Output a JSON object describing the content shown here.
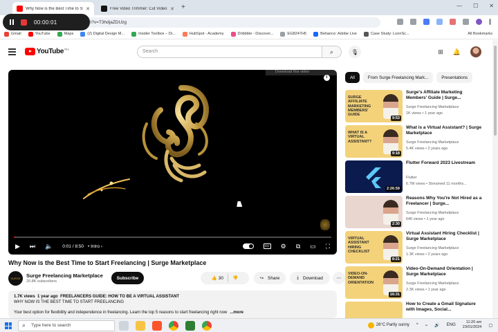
{
  "browser": {
    "tabs": [
      {
        "title": "Why Now is the Best Time to St",
        "favicon_color": "#ff0000"
      },
      {
        "title": "Free Video Trimmer: Cut Video",
        "favicon_color": "#111111"
      }
    ],
    "address": "atch?v=T3hdjaZDUzg",
    "bookmarks": [
      "Gmail",
      "YouTube",
      "Maps",
      "(2) Digital Design M...",
      "Insider Toolbox – Di...",
      "HubSpot - Academy",
      "Dribbble - Discover...",
      "EG8247H5",
      "Behance: Adobe Live",
      "Case Study: LunnSc..."
    ],
    "all_bookmarks": "All Bookmarks"
  },
  "recorder": {
    "time": "00:00:01"
  },
  "youtube": {
    "logo_text": "YouTube",
    "country": "PH",
    "search_placeholder": "Search"
  },
  "player": {
    "overlay_label": "Download this video",
    "progress": 0.002,
    "time_display": "0:01 / 8:50",
    "chapter": "Intro"
  },
  "video": {
    "title": "Why Now is the Best Time to Start Freelancing | Surge Marketplace",
    "channel": "Surge Freelancing Marketplace",
    "channel_avatar_text": "SURGE",
    "subscribers": "20.8K subscribers",
    "subscribe_label": "Subscribe",
    "likes": "30",
    "share_label": "Share",
    "download_label": "Download",
    "description": {
      "views": "1.7K views",
      "ago": "1 year ago",
      "line1": "FREELANCERS GUIDE: HOW TO BE A VIRTUAL ASSISTANT",
      "line2": "WHY NOW IS THE BEST TIME TO START FREELANCING",
      "teaser": "Your best option for flexibility and independence in freelancing. Learn the top 5 reasons to start freelancing right now",
      "more": "...more"
    }
  },
  "chips": [
    "All",
    "From Surge Freelancing Mark...",
    "Presentations"
  ],
  "recommendations": [
    {
      "title": "Surge's Affiliate Marketing Members' Guide | Surge...",
      "channel": "Surge Freelancing Marketplace",
      "views": "1K views",
      "ago": "1 year ago",
      "duration": "9:53",
      "thumb_text": "SURGE AFFILIATE MARKETING MEMBERS' GUIDE",
      "thumb_bg": "#f3d27a",
      "has_face": true
    },
    {
      "title": "What is a Virtual Assistant? | Surge Marketplace",
      "channel": "Surge Freelancing Marketplace",
      "views": "5.4K views",
      "ago": "2 years ago",
      "duration": "9:18",
      "thumb_text": "WHAT IS A VIRTUAL ASSISTANT?",
      "thumb_bg": "#f3d27a",
      "has_face": true
    },
    {
      "title": "Flutter Forward 2023 Livestream",
      "channel": "Flutter",
      "views": "6.7M views",
      "ago": "Streamed 11 months...",
      "duration": "2:26:59",
      "thumb_text": "",
      "thumb_bg": "#0b1b4d",
      "has_face": false
    },
    {
      "title": "Reasons Why You're Not Hired as a Freelancer | Surge...",
      "channel": "Surge Freelancing Marketplace",
      "views": "646 views",
      "ago": "1 year ago",
      "duration": "2:30",
      "thumb_text": "",
      "thumb_bg": "#e8d6cf",
      "has_face": true
    },
    {
      "title": "Virtual Assistant Hiring Checklist | Surge Marketplace",
      "channel": "Surge Freelancing Marketplace",
      "views": "1.3K views",
      "ago": "2 years ago",
      "duration": "8:21",
      "thumb_text": "VIRTUAL ASSISTANT HIRING CHECKLIST",
      "thumb_bg": "#f3d27a",
      "has_face": true
    },
    {
      "title": "Video-On-Demand Orientation | Surge Marketplace",
      "channel": "Surge Freelancing Marketplace",
      "views": "2.3K views",
      "ago": "1 year ago",
      "duration": "16:31",
      "thumb_text": "VIDEO-ON-DEMAND ORIENTATION",
      "thumb_bg": "#f3d27a",
      "has_face": true
    },
    {
      "title": "How to Create a Gmail Signature with Images, Social...",
      "channel": "",
      "views": "",
      "ago": "",
      "duration": "",
      "thumb_text": "",
      "thumb_bg": "#f3d27a",
      "has_face": false
    }
  ],
  "taskbar": {
    "search_placeholder": "Type here to search",
    "weather": "26°C  Partly sunny",
    "lang": "ENG",
    "time": "11:20 am",
    "date": "23/01/2024"
  },
  "colors": {
    "accent": "#ff0000",
    "surge_gold": "#c79a3a"
  }
}
